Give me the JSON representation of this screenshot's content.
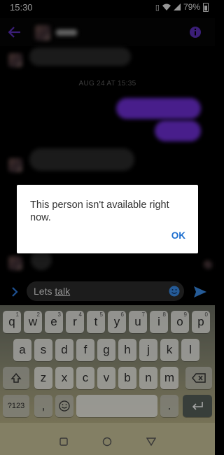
{
  "status_bar": {
    "time": "15:30",
    "battery": "79%"
  },
  "conversation": {
    "date_divider": "AUG 24 AT 15:35"
  },
  "dialog": {
    "message": "This person isn't available right now.",
    "ok_label": "OK"
  },
  "composer": {
    "input_text": "Lets ",
    "input_underlined": "talk"
  },
  "keyboard": {
    "row1": [
      "q",
      "w",
      "e",
      "r",
      "t",
      "y",
      "u",
      "i",
      "o",
      "p"
    ],
    "row1_hints": [
      "1",
      "2",
      "3",
      "4",
      "5",
      "6",
      "7",
      "8",
      "9",
      "0"
    ],
    "row2": [
      "a",
      "s",
      "d",
      "f",
      "g",
      "h",
      "j",
      "k",
      "l"
    ],
    "row3": [
      "z",
      "x",
      "c",
      "v",
      "b",
      "n",
      "m"
    ],
    "symbols_label": "?123",
    "comma": ",",
    "period": "."
  },
  "colors": {
    "accent": "#6f2fd6",
    "ok_blue": "#1e6fcf",
    "send_blue": "#3a8de8"
  }
}
